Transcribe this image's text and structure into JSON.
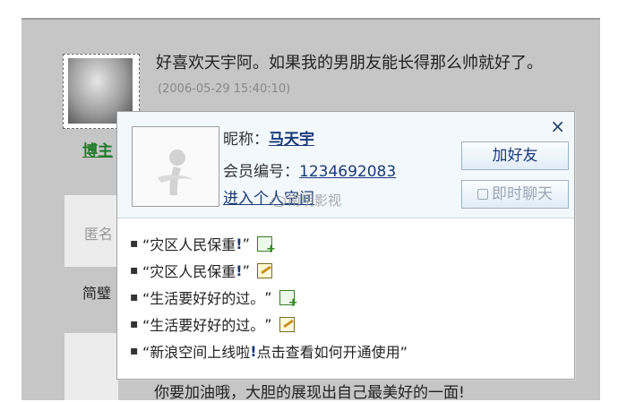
{
  "comment": {
    "text": "好喜欢天宇阿。如果我的男朋友能长得那么帅就好了。",
    "time": "(2006-05-29 15:40:10)"
  },
  "sidebar": {
    "host_label": "博主",
    "anon_label": "匿名",
    "short_name": "简璧"
  },
  "bottom_text": "你要加油哦，大胆的展现出自己最美好的一面!",
  "popup": {
    "close": "×",
    "nickname_label": "昵称：",
    "nickname": "马天宇",
    "member_label": "会员编号：",
    "member_id": "1234692083",
    "space_link": "进入个人空间",
    "add_friend": "加好友",
    "chat": "即时聊天",
    "feed": [
      {
        "open": "“灾区人民保重",
        "excl": "!",
        "close": "”",
        "icon": "add-icon"
      },
      {
        "open": "“灾区人民保重",
        "excl": "!",
        "close": "”",
        "icon": "edit-icon"
      },
      {
        "open": "“生活要好好的过。",
        "excl": "",
        "close": "”",
        "icon": "add-icon"
      },
      {
        "open": "“生活要好好的过。",
        "excl": "",
        "close": "”",
        "icon": "edit-icon"
      },
      {
        "open": "“新浪空间上线啦",
        "excl": "!",
        "close": "点击查看如何开通使用”",
        "icon": ""
      }
    ]
  },
  "watermark": "南明影视",
  "colors": {
    "link": "#1a3a78",
    "host": "#1f7a2a",
    "frame": "#c6c6c6"
  }
}
